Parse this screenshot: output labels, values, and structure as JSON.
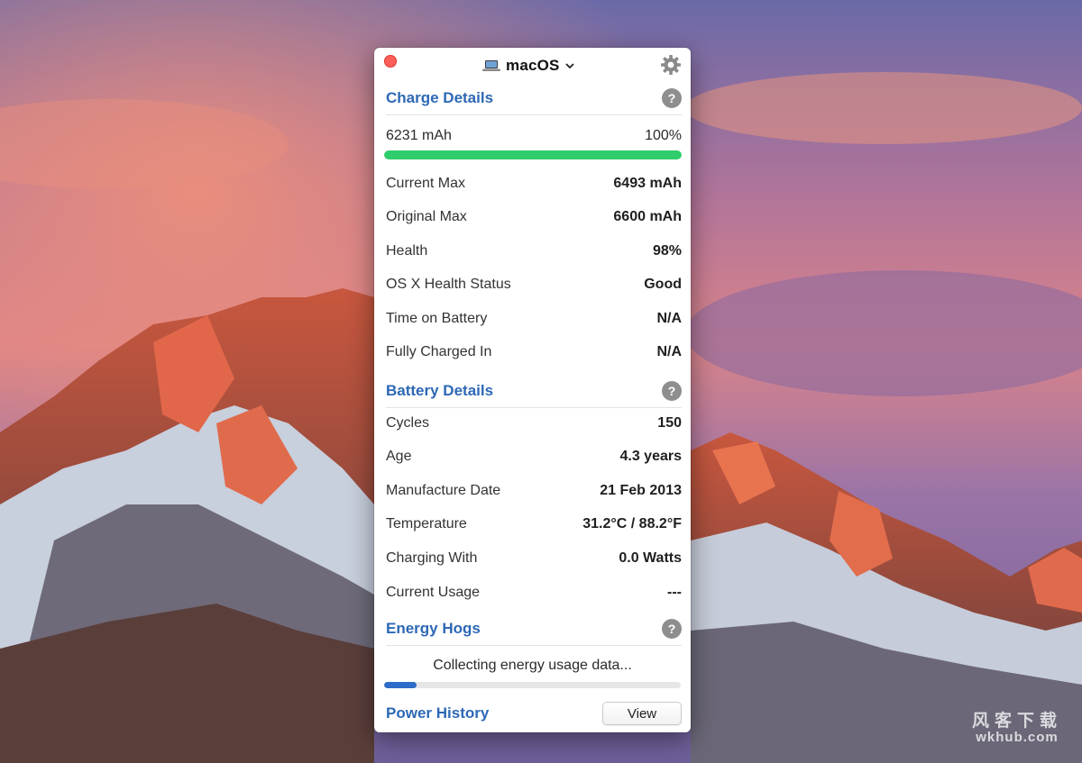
{
  "window": {
    "device_name": "macOS",
    "icons": [
      "close-dot",
      "laptop-icon",
      "chevron-down-icon",
      "gear-icon",
      "help-icon"
    ]
  },
  "charge_details": {
    "title": "Charge Details",
    "help": "?",
    "current_charge": "6231 mAh",
    "percent_text": "100%",
    "charge_fraction": 1.0,
    "rows": [
      {
        "label": "Current Max",
        "value": "6493 mAh"
      },
      {
        "label": "Original Max",
        "value": "6600 mAh"
      },
      {
        "label": "Health",
        "value": "98%"
      },
      {
        "label": "OS X Health Status",
        "value": "Good"
      },
      {
        "label": "Time on Battery",
        "value": "N/A"
      },
      {
        "label": "Fully Charged In",
        "value": "N/A"
      }
    ]
  },
  "battery_details": {
    "title": "Battery Details",
    "help": "?",
    "rows": [
      {
        "label": "Cycles",
        "value": "150"
      },
      {
        "label": "Age",
        "value": "4.3 years"
      },
      {
        "label": "Manufacture Date",
        "value": "21 Feb 2013"
      },
      {
        "label": "Temperature",
        "value": "31.2°C / 88.2°F"
      },
      {
        "label": "Charging With",
        "value": "0.0 Watts"
      },
      {
        "label": "Current Usage",
        "value": "---"
      }
    ]
  },
  "energy_hogs": {
    "title": "Energy Hogs",
    "help": "?",
    "status": "Collecting energy usage data...",
    "progress_fraction": 0.11
  },
  "power_history": {
    "title": "Power History",
    "button": "View"
  },
  "watermark": {
    "line1": "风客下载",
    "line2": "wkhub.com"
  },
  "colors": {
    "accent_blue": "#2d68b5",
    "charge_green": "#2fcd6b",
    "close_red": "#fc5f57"
  }
}
